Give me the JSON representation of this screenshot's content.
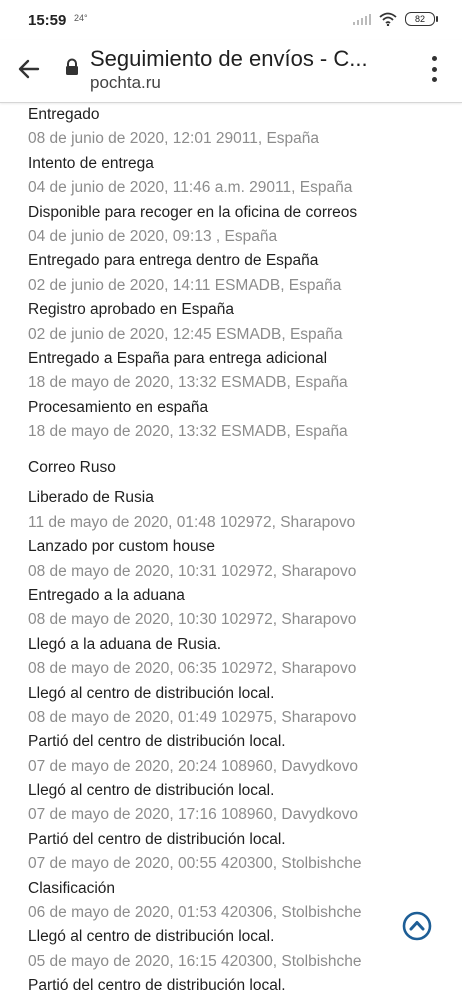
{
  "status_bar": {
    "time": "15:59",
    "temperature": "24°",
    "battery": "82"
  },
  "browser": {
    "title": "Seguimiento de envíos - C...",
    "url": "pochta.ru"
  },
  "sections": [
    {
      "events": [
        {
          "event": "Entregado",
          "meta": "08 de junio de 2020, 12:01 29011, España"
        },
        {
          "event": "Intento de entrega",
          "meta": "04 de junio de 2020, 11:46 a.m. 29011, España"
        },
        {
          "event": "Disponible para recoger en la oficina de correos",
          "meta": "04 de junio de 2020, 09:13 , España"
        },
        {
          "event": "Entregado para entrega dentro de España",
          "meta": "02 de junio de 2020, 14:11 ESMADB, España"
        },
        {
          "event": "Registro aprobado en España",
          "meta": "02 de junio de 2020, 12:45 ESMADB, España"
        },
        {
          "event": "Entregado a España para entrega adicional",
          "meta": "18 de mayo de 2020, 13:32 ESMADB, España"
        },
        {
          "event": "Procesamiento en españa",
          "meta": "18 de mayo de 2020, 13:32 ESMADB, España"
        }
      ]
    },
    {
      "heading": "Correo Ruso",
      "events": [
        {
          "event": "Liberado de Rusia",
          "meta": "11 de mayo de 2020, 01:48 102972, Sharapovo"
        },
        {
          "event": "Lanzado por custom house",
          "meta": "08 de mayo de 2020, 10:31 102972, Sharapovo"
        },
        {
          "event": "Entregado a la aduana",
          "meta": "08 de mayo de 2020, 10:30 102972, Sharapovo"
        },
        {
          "event": "Llegó a la aduana de Rusia.",
          "meta": "08 de mayo de 2020, 06:35 102972, Sharapovo"
        },
        {
          "event": "Llegó al centro de distribución local.",
          "meta": "08 de mayo de 2020, 01:49 102975, Sharapovo"
        },
        {
          "event": "Partió del centro de distribución local.",
          "meta": "07 de mayo de 2020, 20:24 108960, Davydkovo"
        },
        {
          "event": "Llegó al centro de distribución local.",
          "meta": "07 de mayo de 2020, 17:16 108960, Davydkovo"
        },
        {
          "event": "Partió del centro de distribución local.",
          "meta": "07 de mayo de 2020, 00:55 420300, Stolbishche"
        },
        {
          "event": "Clasificación",
          "meta": "06 de mayo de 2020, 01:53 420306, Stolbishche"
        },
        {
          "event": "Llegó al centro de distribución local.",
          "meta": "05 de mayo de 2020, 16:15 420300, Stolbishche"
        },
        {
          "event": "Partió del centro de distribución local.",
          "meta": ""
        }
      ]
    }
  ]
}
